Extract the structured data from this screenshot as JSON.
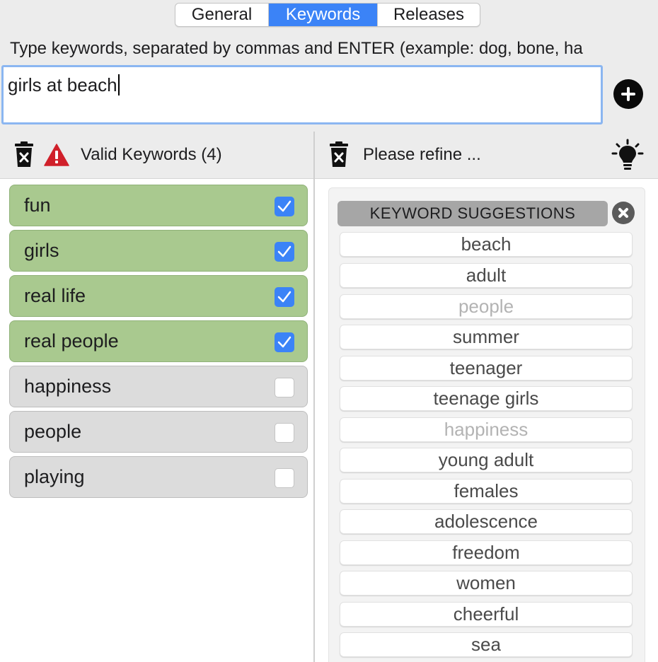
{
  "tabs": [
    {
      "label": "General",
      "active": false
    },
    {
      "label": "Keywords",
      "active": true
    },
    {
      "label": "Releases",
      "active": false
    }
  ],
  "hint": "Type keywords, separated by commas and ENTER (example: dog, bone, ha",
  "input": {
    "value": "girls at beach"
  },
  "left_panel": {
    "title": "Valid Keywords (4)",
    "items": [
      {
        "label": "fun",
        "checked": true
      },
      {
        "label": "girls",
        "checked": true
      },
      {
        "label": "real life",
        "checked": true
      },
      {
        "label": "real people",
        "checked": true
      },
      {
        "label": "happiness",
        "checked": false
      },
      {
        "label": "people",
        "checked": false
      },
      {
        "label": "playing",
        "checked": false
      }
    ]
  },
  "right_panel": {
    "title": "Please refine ...",
    "suggestions_title": "KEYWORD SUGGESTIONS",
    "suggestions": [
      {
        "label": "beach",
        "dim": false
      },
      {
        "label": "adult",
        "dim": false
      },
      {
        "label": "people",
        "dim": true
      },
      {
        "label": "summer",
        "dim": false
      },
      {
        "label": "teenager",
        "dim": false
      },
      {
        "label": "teenage girls",
        "dim": false
      },
      {
        "label": "happiness",
        "dim": true
      },
      {
        "label": "young adult",
        "dim": false
      },
      {
        "label": "females",
        "dim": false
      },
      {
        "label": "adolescence",
        "dim": false
      },
      {
        "label": "freedom",
        "dim": false
      },
      {
        "label": "women",
        "dim": false
      },
      {
        "label": "cheerful",
        "dim": false
      },
      {
        "label": "sea",
        "dim": false
      }
    ]
  },
  "colors": {
    "accent": "#3b83f7",
    "valid_row": "#a9c98f",
    "invalid_row": "#dcdcdc",
    "warning": "#d0202a"
  },
  "icons": [
    "trash-icon",
    "warning-icon",
    "add-icon",
    "lightbulb-icon",
    "close-icon",
    "checkmark-icon"
  ]
}
